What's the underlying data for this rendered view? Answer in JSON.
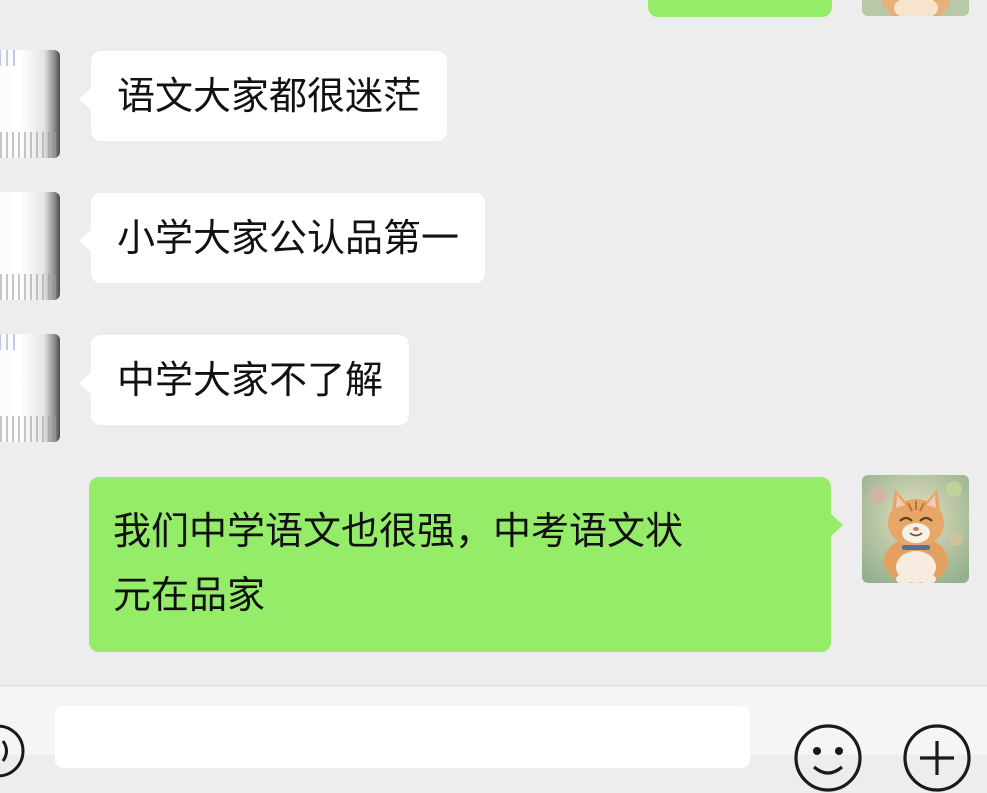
{
  "messages": [
    {
      "side": "out",
      "text": ""
    },
    {
      "side": "in",
      "text": "语文大家都很迷茫"
    },
    {
      "side": "in",
      "text": "小学大家公认品第一"
    },
    {
      "side": "in",
      "text": "中学大家不了解"
    },
    {
      "side": "out",
      "text": "我们中学语文也很强，中考语文状\n元在品家"
    }
  ],
  "input_bar": {
    "message_value": "",
    "icons": [
      "voice-icon",
      "emoji-icon",
      "add-icon"
    ]
  },
  "colors": {
    "background": "#ededed",
    "incoming_bubble": "#ffffff",
    "outgoing_bubble": "#95ec69",
    "input_bar": "#f5f5f5"
  }
}
